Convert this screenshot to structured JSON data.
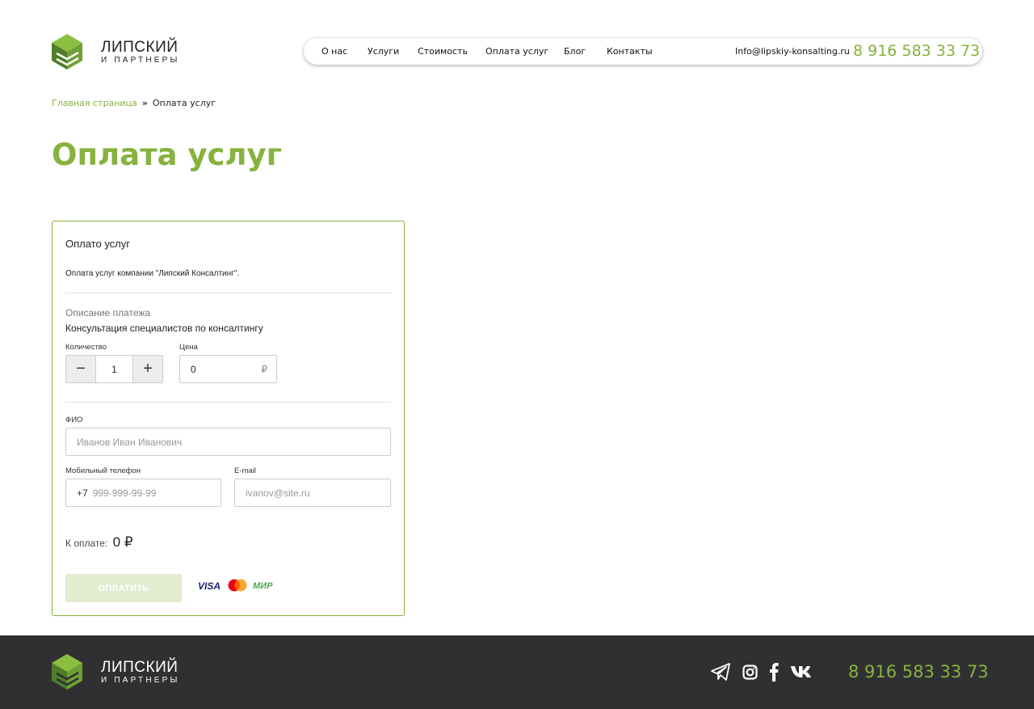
{
  "header": {
    "logo": {
      "name": "ЛИПСКИЙ",
      "sub": "И ПАРТНЕРЫ"
    },
    "nav": [
      "О нас",
      "Услуги",
      "Стоимость",
      "Оплата услуг",
      "Блог",
      "Контакты"
    ],
    "email": "Info@lipskiy-konsalting.ru",
    "phone": "8 916 583 33 73"
  },
  "breadcrumb": {
    "home": "Главная страница",
    "separator": "»",
    "current": "Оплата услуг"
  },
  "page_title": "Оплата услуг",
  "form": {
    "title": "Оплато услуг",
    "description": "Оплата услуг компании \"Липский Консалтинг\".",
    "payment_description_label": "Описание платежа",
    "payment_description_value": "Консультация специалистов по консалтингу",
    "quantity_label": "Количество",
    "quantity_value": "1",
    "minus": "−",
    "plus": "+",
    "price_label": "Цена",
    "price_value": "0",
    "currency": "₽",
    "name_label": "ФИО",
    "name_placeholder": "Иванов Иван Иванович",
    "phone_label": "Мобильный телефон",
    "phone_prefix": "+7",
    "phone_placeholder": "999-999-99-99",
    "email_label": "E-mail",
    "email_placeholder": "ivanov@site.ru",
    "total_label": "К оплате:",
    "total_value": "0 ₽",
    "pay_button": "ОПЛАТИТЬ",
    "payment_systems": {
      "visa": "VISA",
      "mir": "МИР"
    }
  },
  "footer": {
    "logo": {
      "name": "ЛИПСКИЙ",
      "sub": "И ПАРТНЕРЫ"
    },
    "socials": [
      "telegram-icon",
      "instagram-icon",
      "facebook-icon",
      "vk-icon"
    ],
    "phone": "8 916 583 33 73"
  },
  "colors": {
    "accent": "#86b23d",
    "footer_bg": "#303032",
    "button_disabled": "#e1ecd1"
  }
}
